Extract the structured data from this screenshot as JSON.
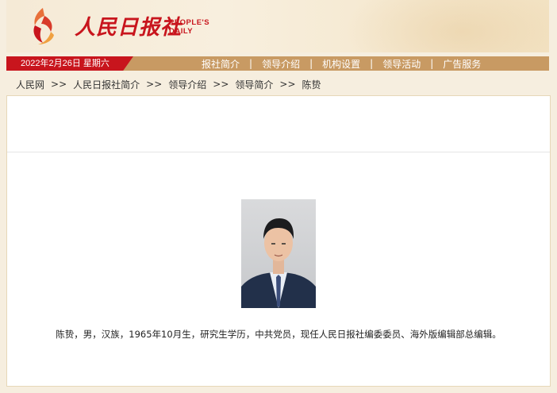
{
  "header": {
    "logo_cn": "人民日报社",
    "logo_en_line1": "PEOPLE'S",
    "logo_en_line2": "DAILY"
  },
  "navbar": {
    "date": "2022年2月26日 星期六",
    "links": [
      "报社简介",
      "领导介绍",
      "机构设置",
      "领导活动",
      "广告服务"
    ]
  },
  "breadcrumb": {
    "items": [
      "人民网",
      "人民日报社简介",
      "领导介绍",
      "领导简介",
      "陈贽"
    ],
    "separator": ">>"
  },
  "profile": {
    "bio": "陈贽，男，汉族，1965年10月生，研究生学历，中共党员，现任人民日报社编委委员、海外版编辑部总编辑。"
  },
  "colors": {
    "brand_red": "#c8151d",
    "nav_tan": "#c89a63",
    "background": "#f6eedf"
  }
}
